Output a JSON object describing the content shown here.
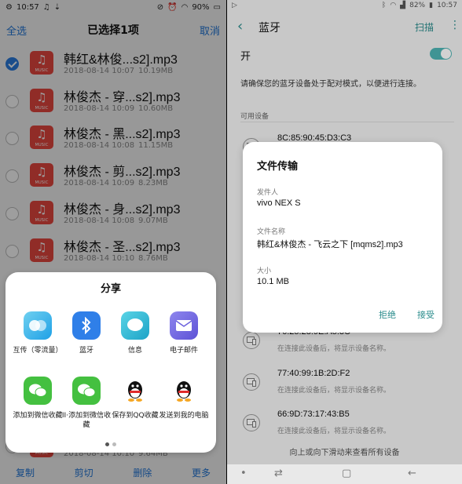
{
  "left": {
    "status": {
      "time": "10:57",
      "battery": "90%"
    },
    "topbar": {
      "select_all": "全选",
      "title": "已选择1项",
      "cancel": "取消"
    },
    "files": [
      {
        "name": "韩红&林俊...s2].mp3",
        "date": "2018-08-14 10:07",
        "size": "10.19MB",
        "checked": true
      },
      {
        "name": "林俊杰 - 穿...s2].mp3",
        "date": "2018-08-14 10:09",
        "size": "10.60MB",
        "checked": false
      },
      {
        "name": "林俊杰 - 黑...s2].mp3",
        "date": "2018-08-14 10:08",
        "size": "11.15MB",
        "checked": false
      },
      {
        "name": "林俊杰 - 剪...s2].mp3",
        "date": "2018-08-14 10:09",
        "size": "8.23MB",
        "checked": false
      },
      {
        "name": "林俊杰 - 身...s2].mp3",
        "date": "2018-08-14 10:08",
        "size": "9.07MB",
        "checked": false
      },
      {
        "name": "林俊杰 - 圣...s2].mp3",
        "date": "2018-08-14 10:10",
        "size": "8.76MB",
        "checked": false
      },
      {
        "name": "",
        "date": "2018-08-14 10:10",
        "size": "9.64MB",
        "checked": false
      }
    ],
    "file_icon_tag": "MUSIC",
    "share": {
      "title": "分享",
      "items": [
        {
          "label": "互传（零流量）",
          "icon": "mutual-transfer-icon"
        },
        {
          "label": "蓝牙",
          "icon": "bluetooth-icon"
        },
        {
          "label": "信息",
          "icon": "message-icon"
        },
        {
          "label": "电子邮件",
          "icon": "email-icon"
        },
        {
          "label": "添加到微信收藏",
          "icon": "wechat-icon"
        },
        {
          "label": "II·添加到微信收藏",
          "icon": "wechat-clone-icon"
        },
        {
          "label": "保存到QQ收藏",
          "icon": "qq-icon"
        },
        {
          "label": "发送到我的电脑",
          "icon": "qq-icon"
        }
      ]
    },
    "bottombar": {
      "copy": "复制",
      "cut": "剪切",
      "delete": "删除",
      "more": "更多"
    }
  },
  "right": {
    "status": {
      "battery": "82%",
      "time": "10:57"
    },
    "appbar": {
      "title": "蓝牙",
      "scan": "扫描"
    },
    "toggle_label": "开",
    "toggle_on": true,
    "hint": "请确保您的蓝牙设备处于配对模式，以便进行连接。",
    "section": "可用设备",
    "devices": [
      {
        "name": "8C:85:90:45:D3:C3",
        "sub": ""
      },
      {
        "name": "76:25:28:9E:A5:3C",
        "sub": "在连接此设备后，将显示设备名称。"
      },
      {
        "name": "77:40:99:1B:2D:F2",
        "sub": "在连接此设备后，将显示设备名称。"
      },
      {
        "name": "66:9D:73:17:43:B5",
        "sub": "在连接此设备后，将显示设备名称。"
      }
    ],
    "scroll_hint": "向上或向下滑动来查看所有设备",
    "dialog": {
      "title": "文件传输",
      "sender_label": "发件人",
      "sender": "vivo NEX S",
      "filename_label": "文件名称",
      "filename": "韩红&林俊杰 - 飞云之下 [mqms2].mp3",
      "size_label": "大小",
      "size": "10.1 MB",
      "reject": "拒绝",
      "accept": "接受"
    }
  },
  "colors": {
    "left_accent": "#2176d9",
    "right_accent": "#2a8c8c",
    "music_icon": "#e8473f"
  }
}
